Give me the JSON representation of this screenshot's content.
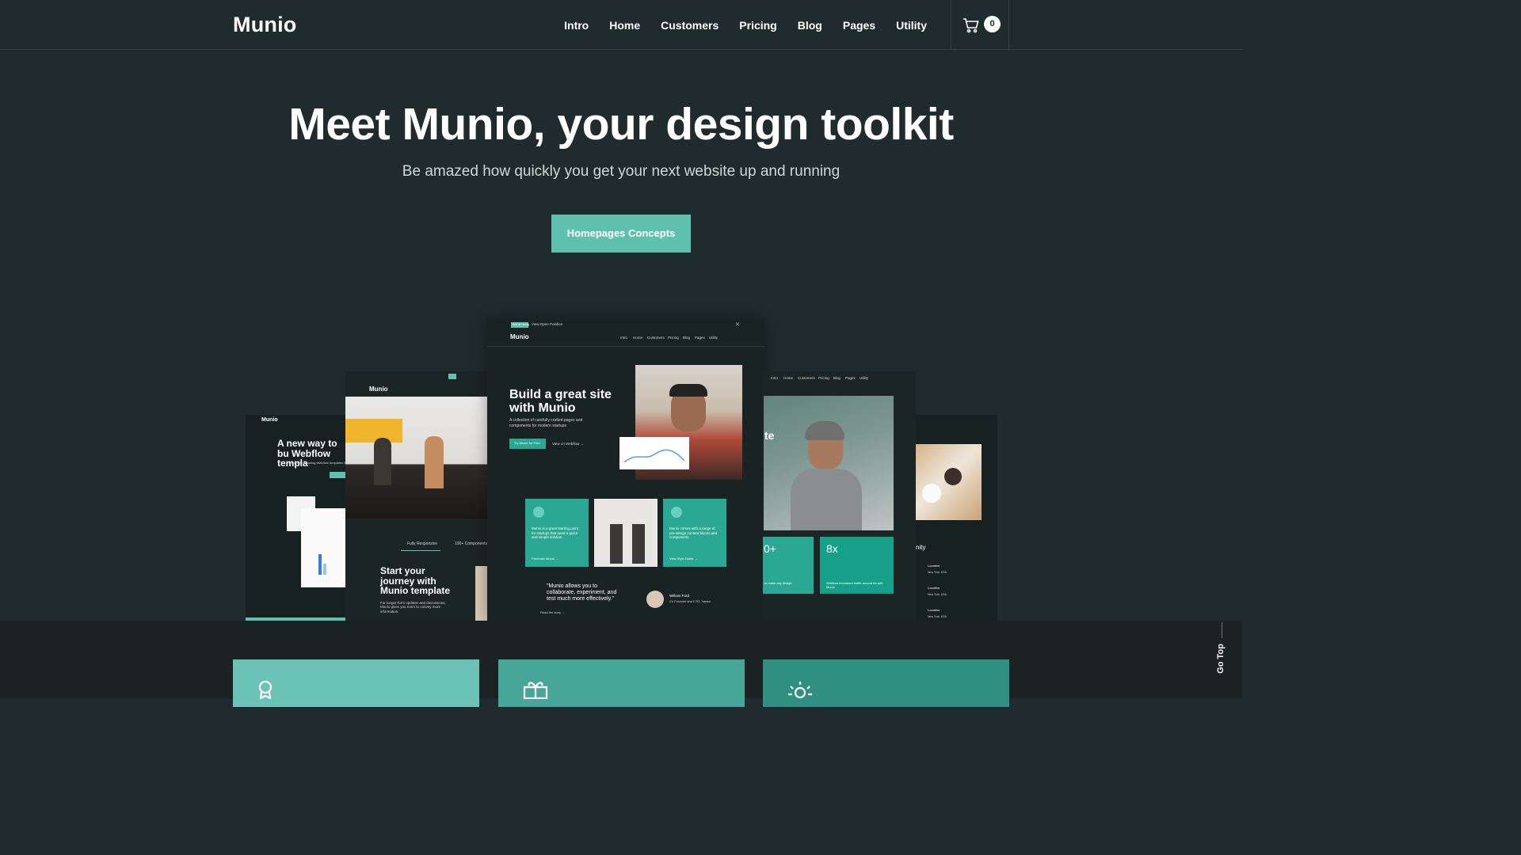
{
  "nav": {
    "logo": "Munio",
    "items": [
      "Intro",
      "Home",
      "Customers",
      "Pricing",
      "Blog",
      "Pages",
      "Utility"
    ],
    "cart_count": "0"
  },
  "hero": {
    "title": "Meet Munio, your design toolkit",
    "subtitle": "Be amazed how quickly you get your next website up and running",
    "cta_label": "Homepages Concepts"
  },
  "mockups": {
    "m1": {
      "logo": "Munio",
      "headline": "A new way to bu Webflow templa",
      "sub": "We create amazing Webflow templates fo"
    },
    "m2": {
      "logo": "Munio",
      "tab1": "Fully Responsive",
      "tab2": "100+ Components",
      "headline": "Start your journey with Munio template",
      "body": "For longer-form updates and discussions, Munio gives you room to convey more information."
    },
    "m3": {
      "banner_tag": "We're hiring",
      "banner_text": "View Open Position",
      "logo": "Munio",
      "menu": [
        "Intro",
        "Home",
        "Customers",
        "Pricing",
        "Blog",
        "Pages",
        "Utility"
      ],
      "headline": "Build a great site with Munio",
      "body": "A collection of carefully crafted pages and components for modern startups",
      "btn1": "Try Munio for Free",
      "btn2": "View on Webflow →",
      "card1": "Munio is a great starting point for startups that need a quick and simple solution",
      "card1_link": "Purchase Munio →",
      "card2": "Munio comes with a range of pre-design content blocks and components",
      "card2_link": "View Style Guide →",
      "quote": "\"Munio allows you to collaborate, experiment, and test much more effectively.\"",
      "quote_link": "Read the story →",
      "author": "William Ford",
      "author_role": "Co Founder and CTO, Vanka"
    },
    "m4": {
      "menu": [
        "Intro",
        "Home",
        "Customers",
        "Pricing",
        "Blog",
        "Pages",
        "Utility"
      ],
      "stat1": "0+",
      "stat2": "8x",
      "stat2_text": "Webflow increased traffic around 8x with Munio",
      "stat1_text": "to make any design",
      "partial": "te"
    },
    "m5": {
      "heading": "nity",
      "loc1": "Location",
      "loc2": "Location",
      "loc3": "Location",
      "city": "New York, USA"
    }
  },
  "go_top": "Go Top",
  "colors": {
    "bg": "#1f2b2c",
    "accent": "#5fc0ad",
    "card1": "#6ac3b6",
    "card2": "#46a798",
    "card3": "#2f8f80"
  },
  "icons": [
    "cart-icon",
    "award-icon",
    "gift-icon",
    "sun-icon"
  ]
}
